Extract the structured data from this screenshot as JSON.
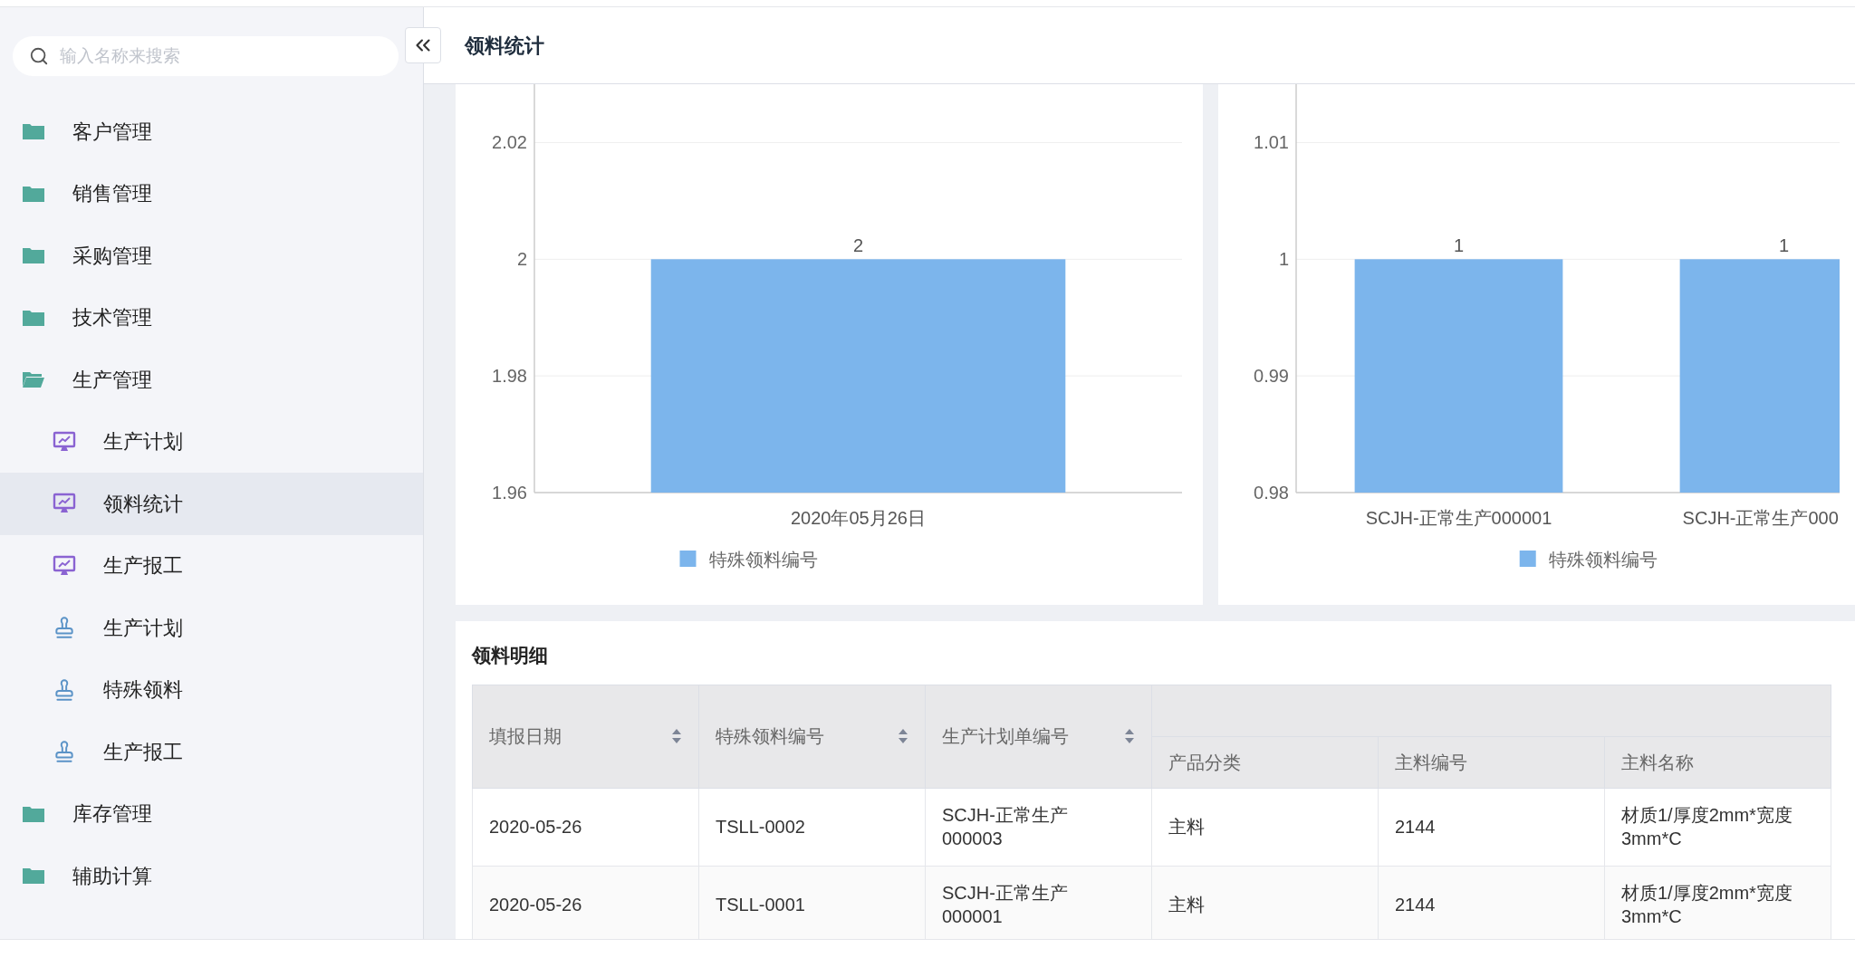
{
  "sidebar": {
    "search": {
      "placeholder": "输入名称来搜索"
    },
    "items": [
      {
        "label": "客户管理",
        "expanded": false,
        "selected": false
      },
      {
        "label": "销售管理",
        "expanded": false,
        "selected": false
      },
      {
        "label": "采购管理",
        "expanded": false,
        "selected": false
      },
      {
        "label": "技术管理",
        "expanded": false,
        "selected": false
      },
      {
        "label": "生产管理",
        "expanded": true,
        "selected": false,
        "children": [
          {
            "label": "生产计划",
            "kind": "monitor",
            "selected": false
          },
          {
            "label": "领料统计",
            "kind": "monitor",
            "selected": true
          },
          {
            "label": "生产报工",
            "kind": "monitor",
            "selected": false
          },
          {
            "label": "生产计划",
            "kind": "stamp",
            "selected": false
          },
          {
            "label": "特殊领料",
            "kind": "stamp",
            "selected": false
          },
          {
            "label": "生产报工",
            "kind": "stamp",
            "selected": false
          }
        ]
      },
      {
        "label": "库存管理",
        "expanded": false,
        "selected": false
      },
      {
        "label": "辅助计算",
        "expanded": false,
        "selected": false
      }
    ]
  },
  "page": {
    "title": "领料统计"
  },
  "charts": [
    {
      "chart_data": {
        "type": "bar",
        "categories": [
          "2020年05月26日"
        ],
        "series": [
          {
            "name": "特殊领料编号",
            "color": "#7cb5ec",
            "values": [
              2
            ]
          }
        ],
        "ylim": [
          1.96,
          2.03
        ],
        "yticks": [
          1.96,
          1.98,
          2,
          2.02
        ],
        "grid": true,
        "data_labels": true
      }
    },
    {
      "chart_data": {
        "type": "bar",
        "categories": [
          "SCJH-正常生产000001",
          "SCJH-正常生产000"
        ],
        "series": [
          {
            "name": "特殊领料编号",
            "color": "#7cb5ec",
            "values": [
              1,
              1
            ]
          }
        ],
        "ylim": [
          0.98,
          1.015
        ],
        "yticks": [
          0.98,
          0.99,
          1,
          1.01
        ],
        "grid": true,
        "data_labels": true
      }
    }
  ],
  "table": {
    "title": "领料明细",
    "columns": [
      {
        "label": "填报日期",
        "sortable": true
      },
      {
        "label": "特殊领料编号",
        "sortable": true
      },
      {
        "label": "生产计划单编号",
        "sortable": true
      }
    ],
    "subcolumns": [
      "产品分类",
      "主料编号",
      "主料名称"
    ],
    "rows": [
      [
        "2020-05-26",
        "TSLL-0002",
        "SCJH-正常生产000003",
        "主料",
        "2144",
        "材质1/厚度2mm*宽度3mm*C"
      ],
      [
        "2020-05-26",
        "TSLL-0001",
        "SCJH-正常生产000001",
        "主料",
        "2144",
        "材质1/厚度2mm*宽度3mm*C"
      ]
    ]
  }
}
